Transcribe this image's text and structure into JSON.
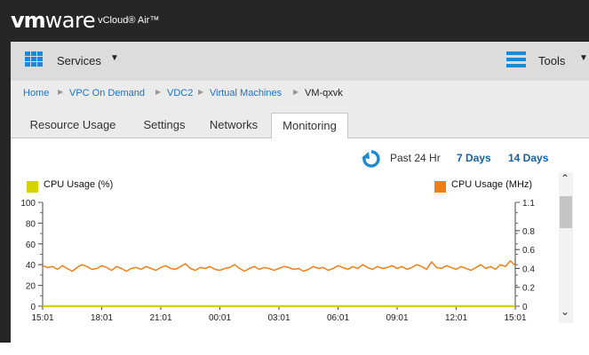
{
  "app": {
    "logo_vm": "vm",
    "logo_ware": "ware",
    "product": "vCloud® Air™"
  },
  "menubar": {
    "services_label": "Services",
    "tools_label": "Tools"
  },
  "breadcrumb": [
    "Home",
    "VPC On Demand",
    "VDC2",
    "Virtual Machines",
    "VM-qxvk"
  ],
  "tabs": [
    {
      "label": "Resource Usage",
      "active": false
    },
    {
      "label": "Settings",
      "active": false
    },
    {
      "label": "Networks",
      "active": false
    },
    {
      "label": "Monitoring",
      "active": true
    }
  ],
  "time_range": {
    "options": [
      "Past 24 Hr",
      "7 Days",
      "14 Days"
    ],
    "selected": "Past 24 Hr"
  },
  "chart_data": {
    "type": "line",
    "x_ticks": [
      "15:01",
      "18:01",
      "21:01",
      "00:01",
      "03:01",
      "06:01",
      "09:01",
      "12:01",
      "15:01"
    ],
    "y_left": {
      "ticks": [
        "100",
        "80",
        "60",
        "40",
        "20",
        "0"
      ],
      "range": [
        0,
        100
      ]
    },
    "y_right": {
      "ticks": [
        "1.1",
        "0.8",
        "0.6",
        "0.4",
        "0.2",
        "0"
      ],
      "range": [
        0,
        1.1
      ]
    },
    "series": [
      {
        "name": "CPU Usage (%)",
        "color": "#d4d400",
        "axis": "left",
        "values": [
          0,
          0,
          0,
          0,
          0,
          0,
          0,
          0,
          0,
          0,
          0,
          0,
          0,
          0,
          0,
          0,
          0,
          0,
          0,
          0,
          0,
          0,
          0,
          0,
          0,
          0,
          0,
          0,
          0,
          0,
          0,
          0,
          0,
          0,
          0,
          0,
          0,
          0,
          0,
          0,
          0,
          0,
          0,
          0,
          0,
          0,
          0,
          0,
          0,
          0,
          0,
          0,
          0,
          0,
          0,
          0,
          0,
          0,
          0,
          0,
          0,
          0,
          0,
          0,
          0,
          0,
          0,
          0,
          0,
          0,
          0,
          0,
          0,
          0,
          0,
          0,
          0,
          0,
          0,
          0,
          0,
          0,
          0,
          0,
          0,
          0,
          0,
          0,
          0,
          0,
          0,
          0,
          0,
          0,
          0,
          0,
          0
        ]
      },
      {
        "name": "CPU Usage (MHz)",
        "color": "#f07f17",
        "axis": "right",
        "values": [
          0.43,
          0.41,
          0.42,
          0.39,
          0.43,
          0.4,
          0.37,
          0.41,
          0.44,
          0.42,
          0.39,
          0.4,
          0.43,
          0.41,
          0.38,
          0.42,
          0.4,
          0.37,
          0.4,
          0.41,
          0.39,
          0.42,
          0.4,
          0.38,
          0.41,
          0.43,
          0.4,
          0.39,
          0.42,
          0.45,
          0.4,
          0.38,
          0.41,
          0.4,
          0.42,
          0.39,
          0.38,
          0.4,
          0.41,
          0.44,
          0.4,
          0.37,
          0.4,
          0.42,
          0.39,
          0.41,
          0.4,
          0.38,
          0.4,
          0.42,
          0.41,
          0.39,
          0.4,
          0.37,
          0.39,
          0.42,
          0.4,
          0.41,
          0.38,
          0.4,
          0.43,
          0.41,
          0.39,
          0.42,
          0.4,
          0.44,
          0.41,
          0.39,
          0.42,
          0.4,
          0.41,
          0.43,
          0.4,
          0.42,
          0.39,
          0.41,
          0.44,
          0.42,
          0.39,
          0.47,
          0.41,
          0.4,
          0.43,
          0.41,
          0.39,
          0.42,
          0.4,
          0.38,
          0.41,
          0.44,
          0.4,
          0.42,
          0.39,
          0.44,
          0.42,
          0.48,
          0.43
        ]
      }
    ]
  }
}
